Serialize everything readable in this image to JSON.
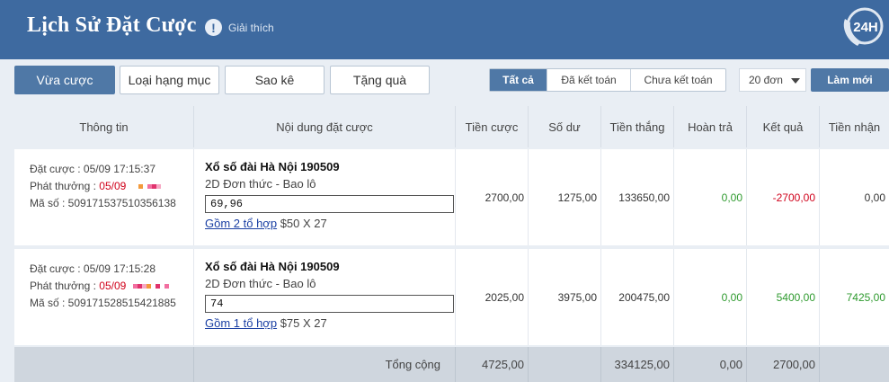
{
  "header": {
    "title": "Lịch Sử Đặt Cược",
    "help_label": "Giải thích",
    "support_badge": "24H"
  },
  "toolbar": {
    "tabs": [
      "Vừa cược",
      "Loại hạng mục",
      "Sao kê",
      "Tặng quà"
    ],
    "filters": [
      "Tất cả",
      "Đã kết toán",
      "Chưa kết toán"
    ],
    "page_size": "20 đơn",
    "refresh_label": "Làm mới"
  },
  "table": {
    "headers": [
      "Thông tin",
      "Nội dung đặt cược",
      "Tiền cược",
      "Số dư",
      "Tiền thắng",
      "Hoàn trả",
      "Kết quả",
      "Tiền nhận"
    ],
    "rows": [
      {
        "bet_time": "Đặt cược : 05/09 17:15:37",
        "payout_label": "Phát thưởng : ",
        "payout_date": "05/09",
        "code": "Mã số : 509171537510356138",
        "lottery": "Xổ số đài Hà Nội 190509",
        "type": "2D Đơn thức - Bao lô",
        "numbers": "69,96",
        "combo_link": "Gồm 2 tổ hợp",
        "combo_detail": " $50 X 27",
        "stake": "2700,00",
        "balance": "1275,00",
        "winnings": "133650,00",
        "refund": "0,00",
        "result": "-2700,00",
        "received": "0,00"
      },
      {
        "bet_time": "Đặt cược : 05/09 17:15:28",
        "payout_label": "Phát thưởng : ",
        "payout_date": "05/09",
        "code": "Mã số : 509171528515421885",
        "lottery": "Xổ số đài Hà Nội 190509",
        "type": "2D Đơn thức - Bao lô",
        "numbers": "74",
        "combo_link": "Gồm 1 tổ hợp",
        "combo_detail": " $75 X 27",
        "stake": "2025,00",
        "balance": "3975,00",
        "winnings": "200475,00",
        "refund": "0,00",
        "result": "5400,00",
        "received": "7425,00"
      }
    ],
    "total": {
      "label": "Tổng cộng",
      "stake": "4725,00",
      "winnings": "334125,00",
      "refund": "0,00",
      "result": "2700,00"
    }
  },
  "colors": {
    "header_bg": "#3e6aa0",
    "accent": "#4f78a6",
    "negative": "#d0021b",
    "positive": "#2e9a2e"
  }
}
